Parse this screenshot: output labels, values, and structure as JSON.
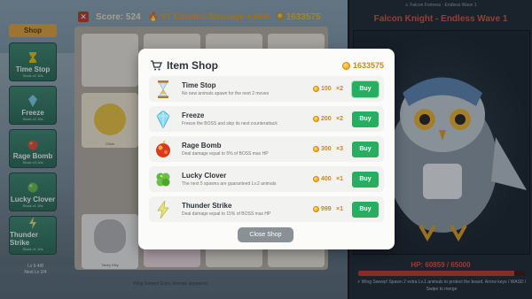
{
  "topbar": {
    "close_icon": "close-icon",
    "score": "Score: 524",
    "combo": "🔥 57 Combo! Damage +45%",
    "gold": "1633575"
  },
  "sidebar": {
    "shop_tab": "Shop",
    "items": [
      {
        "name": "Time Stop",
        "sub": "Stock x2  10s",
        "icon": "hourglass-icon",
        "color": "#f1c40f"
      },
      {
        "name": "Freeze",
        "sub": "Stock x2  10s",
        "icon": "ice-crystal-icon",
        "color": "#7fd3f0"
      },
      {
        "name": "Rage Bomb",
        "sub": "Stock x3  10s",
        "icon": "bomb-icon",
        "color": "#e74c3c"
      },
      {
        "name": "Lucky Clover",
        "sub": "Stock x1  10s",
        "icon": "clover-icon",
        "color": "#6cc04a"
      },
      {
        "name": "Thunder Strike",
        "sub": "Stock x1  10s",
        "icon": "lightning-crystal-icon",
        "color": "#e8e27a"
      }
    ],
    "bottom_a": "Lv 5  4/8",
    "bottom_b": "Next Lv 2/4"
  },
  "board": {
    "chick_label": "Chick",
    "kitty_label": "Tabby Kitty",
    "bottom_message": "Wing Sweep! Extra animals appeared!"
  },
  "boss": {
    "topline": "⚔ Falcon Fortress · Endless Wave 1",
    "title": "Falcon Knight - Endless Wave 1",
    "hp_text": "HP: 60859 / 65000",
    "hp_fraction": 0.936,
    "log": "⚡ Wing Sweep! Spawn 2 extra Lv.1 animals to protect the board. Arrow keys / WASD / Swipe to merge"
  },
  "modal": {
    "title": "Item Shop",
    "gold": "1633575",
    "items": [
      {
        "name": "Time Stop",
        "desc": "No new animals spawn for the next 2 moves",
        "price": "100",
        "qty": "×2",
        "buy": "Buy",
        "icon": "hourglass-icon"
      },
      {
        "name": "Freeze",
        "desc": "Freeze the BOSS and skip its next counterattack",
        "price": "200",
        "qty": "×2",
        "buy": "Buy",
        "icon": "ice-crystal-icon"
      },
      {
        "name": "Rage Bomb",
        "desc": "Deal damage equal to 5% of BOSS max HP",
        "price": "300",
        "qty": "×3",
        "buy": "Buy",
        "icon": "bomb-icon"
      },
      {
        "name": "Lucky Clover",
        "desc": "The next 5 spawns are guaranteed Lv.2 animals",
        "price": "400",
        "qty": "×1",
        "buy": "Buy",
        "icon": "clover-icon"
      },
      {
        "name": "Thunder Strike",
        "desc": "Deal damage equal to 15% of BOSS max HP",
        "price": "999",
        "qty": "×1",
        "buy": "Buy",
        "icon": "lightning-crystal-icon"
      }
    ],
    "close_label": "Close Shop"
  },
  "colors": {
    "buy_button": "#27ae60",
    "gold_text": "#c98a12",
    "boss_title": "#e74c3c",
    "close_button": "#8a9196"
  }
}
